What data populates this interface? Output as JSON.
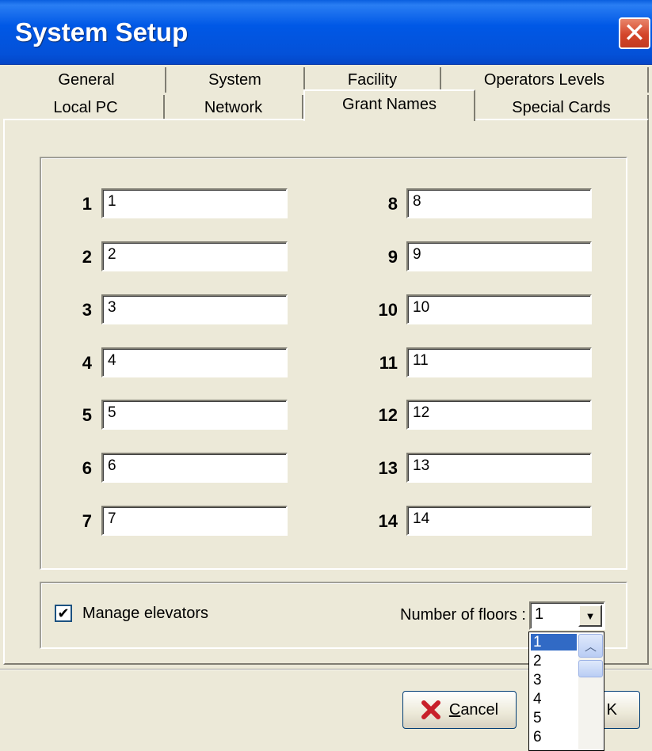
{
  "window": {
    "title": "System Setup"
  },
  "tabs_back": [
    "General",
    "System",
    "Facility",
    "Operators Levels"
  ],
  "tabs_front": [
    "Local PC",
    "Network",
    "Grant Names",
    "Special Cards"
  ],
  "grants_left": [
    {
      "num": "1",
      "value": "1"
    },
    {
      "num": "2",
      "value": "2"
    },
    {
      "num": "3",
      "value": "3"
    },
    {
      "num": "4",
      "value": "4"
    },
    {
      "num": "5",
      "value": "5"
    },
    {
      "num": "6",
      "value": "6"
    },
    {
      "num": "7",
      "value": "7"
    }
  ],
  "grants_right": [
    {
      "num": "8",
      "value": "8"
    },
    {
      "num": "9",
      "value": "9"
    },
    {
      "num": "10",
      "value": "10"
    },
    {
      "num": "11",
      "value": "11"
    },
    {
      "num": "12",
      "value": "12"
    },
    {
      "num": "13",
      "value": "13"
    },
    {
      "num": "14",
      "value": "14"
    }
  ],
  "elevators": {
    "checkbox_label": "Manage elevators",
    "checked": true,
    "check_mark": "✔",
    "floors_label": "Number of floors :",
    "floors_value": "1",
    "floors_options": [
      "1",
      "2",
      "3",
      "4",
      "5",
      "6"
    ]
  },
  "buttons": {
    "cancel_label_first": "C",
    "cancel_label_rest": "ancel",
    "ok_label_visible": "K"
  }
}
